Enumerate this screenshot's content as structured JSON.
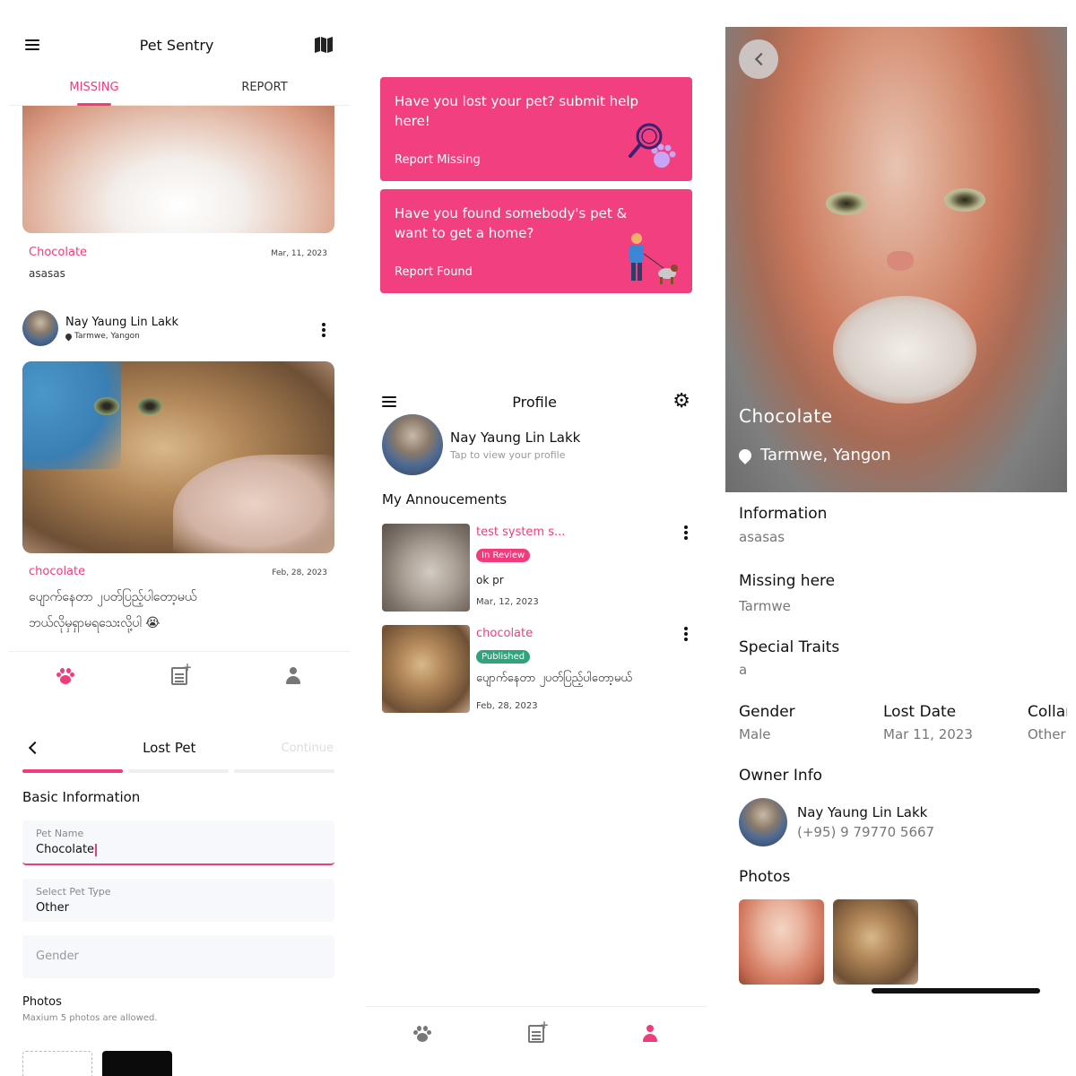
{
  "feed": {
    "title": "Pet Sentry",
    "tabs": [
      "MISSING",
      "REPORT"
    ],
    "posts": [
      {
        "name": "Chocolate",
        "date": "Mar, 11, 2023",
        "desc": "asasas"
      },
      {
        "owner": "Nay Yaung Lin Lakk",
        "location": "Tarmwe, Yangon",
        "name": "chocolate",
        "date": "Feb, 28, 2023",
        "desc_line1": "ပျောက်နေတာ ၂ပတ်ပြည့်ပါတော့မယ်",
        "desc_line2": "ဘယ်လိုမှရှာမရသေးလို့ပါ 😭"
      }
    ]
  },
  "lost_pet_form": {
    "title": "Lost Pet",
    "continue_label": "Continue",
    "section": "Basic Information",
    "pet_name_label": "Pet Name",
    "pet_name_value": "Chocolate",
    "pet_type_label": "Select Pet Type",
    "pet_type_value": "Other",
    "gender_placeholder": "Gender",
    "photos_title": "Photos",
    "photos_hint": "Maxium 5 photos are allowed."
  },
  "report": {
    "lost_title": "Have you lost your pet? submit help here!",
    "lost_link": "Report Missing",
    "found_title": "Have you found somebody's pet & want to get a home?",
    "found_link": "Report Found"
  },
  "profile": {
    "title": "Profile",
    "name": "Nay Yaung Lin Lakk",
    "sub": "Tap to view your profile",
    "section": "My Annoucements",
    "announcements": [
      {
        "title": "test system s...",
        "status": "In Review",
        "text": "ok pr",
        "date": "Mar, 12, 2023"
      },
      {
        "title": "chocolate",
        "status": "Published",
        "text": "ပျောက်နေတာ ၂ပတ်ပြည့်ပါတော့မယ်",
        "date": "Feb, 28, 2023"
      }
    ]
  },
  "details": {
    "name": "Chocolate",
    "location": "Tarmwe, Yangon",
    "info_h": "Information",
    "info_v": "asasas",
    "missing_h": "Missing here",
    "missing_v": "Tarmwe",
    "traits_h": "Special Traits",
    "traits_v": "a",
    "gender_h": "Gender",
    "gender_v": "Male",
    "lost_h": "Lost Date",
    "lost_v": "Mar 11, 2023",
    "collar_h": "Collar",
    "collar_v": "Other",
    "owner_h": "Owner Info",
    "owner_name": "Nay Yaung Lin Lakk",
    "owner_phone": "(+95) 9 79770 5667",
    "photos_h": "Photos"
  },
  "colors": {
    "accent": "#f03c7d",
    "banner": "#f13f7f",
    "published": "#2fa37a",
    "inactive_icon": "#777777"
  },
  "icons": [
    "menu-icon",
    "map-icon",
    "paw-icon",
    "post-add-icon",
    "person-icon",
    "settings-icon",
    "back-icon",
    "location-pin-icon",
    "more-vert-icon"
  ]
}
